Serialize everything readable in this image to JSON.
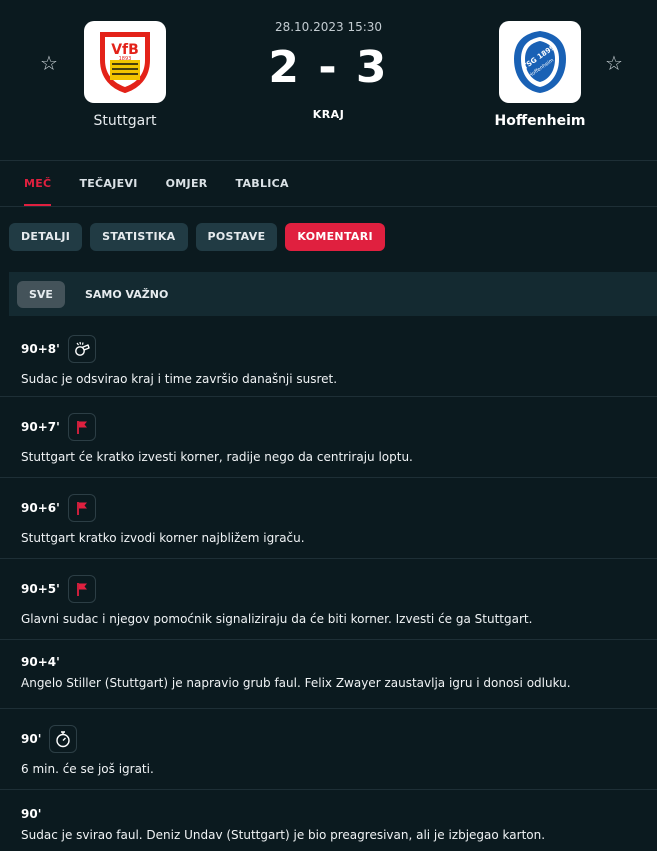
{
  "match": {
    "date": "28.10.2023 15:30",
    "score": "2 - 3",
    "status": "KRAJ",
    "home": {
      "name": "Stuttgart",
      "logo_text": "VfB",
      "logo_sub": "1893"
    },
    "away": {
      "name": "Hoffenheim",
      "logo_text": "TSG 1899",
      "logo_sub": "Hoffenheim"
    }
  },
  "main_tabs": [
    {
      "label": "MEČ",
      "active": true
    },
    {
      "label": "TEČAJEVI",
      "active": false
    },
    {
      "label": "OMJER",
      "active": false
    },
    {
      "label": "TABLICA",
      "active": false
    }
  ],
  "sub_tabs": [
    {
      "label": "DETALJI",
      "active": false
    },
    {
      "label": "STATISTIKA",
      "active": false
    },
    {
      "label": "POSTAVE",
      "active": false
    },
    {
      "label": "KOMENTARI",
      "active": true
    }
  ],
  "filters": [
    {
      "label": "SVE",
      "active": true
    },
    {
      "label": "SAMO VAŽNO",
      "active": false
    }
  ],
  "comments": [
    {
      "minute": "90+8'",
      "icon": "whistle-icon",
      "text": "Sudac je odsvirao kraj i time završio današnji susret."
    },
    {
      "minute": "90+7'",
      "icon": "corner-flag-icon",
      "text": "Stuttgart će kratko izvesti korner, radije nego da centriraju loptu."
    },
    {
      "minute": "90+6'",
      "icon": "corner-flag-icon",
      "text": "Stuttgart kratko izvodi korner najbližem igraču."
    },
    {
      "minute": "90+5'",
      "icon": "corner-flag-icon",
      "text": "Glavni sudac i njegov pomoćnik signaliziraju da će biti korner. Izvesti će ga Stuttgart."
    },
    {
      "minute": "90+4'",
      "icon": "",
      "text": "Angelo Stiller (Stuttgart) je napravio grub faul. Felix Zwayer zaustavlja igru i donosi odluku."
    },
    {
      "minute": "90'",
      "icon": "stopwatch-icon",
      "text": "6 min. će se još igrati."
    },
    {
      "minute": "90'",
      "icon": "",
      "text": "Sudac je svirao faul. Deniz Undav (Stuttgart) je bio preagresivan, ali je izbjegao karton."
    }
  ],
  "colors": {
    "accent": "#e0203f",
    "background": "#0b1a1f",
    "tab_bg": "#213b44"
  }
}
